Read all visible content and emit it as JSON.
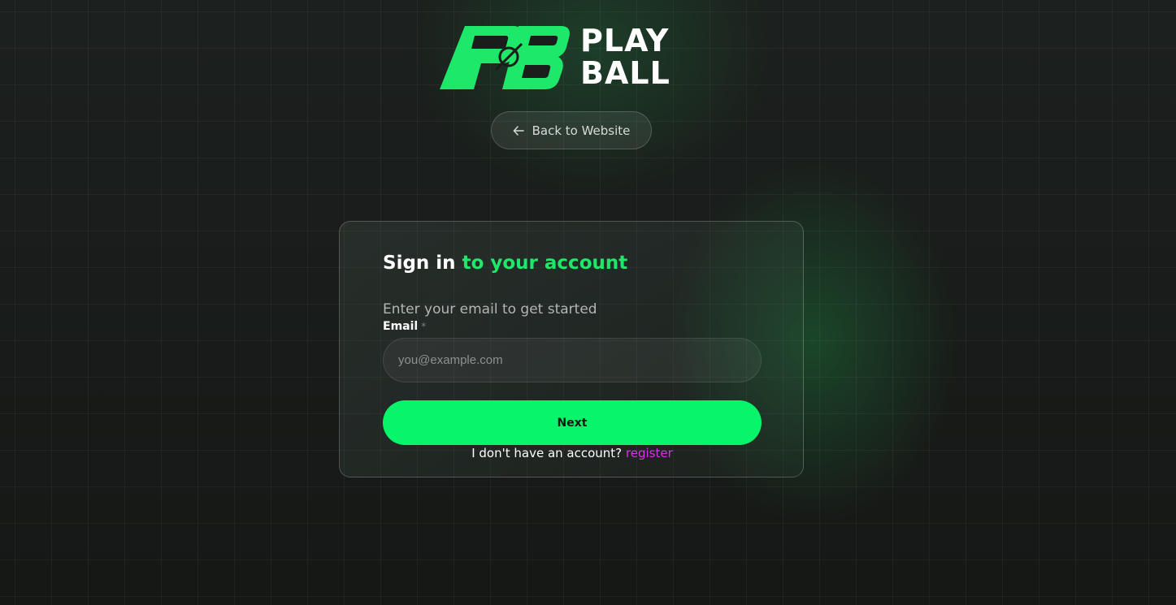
{
  "brand": {
    "logo_line1": "PLAY",
    "logo_line2": "BALL",
    "mark_color": "#1ee86a",
    "mark_icon": "pb-logo-mark"
  },
  "back_button": {
    "label": "Back to Website",
    "icon": "arrow-left-icon"
  },
  "card": {
    "title_white": "Sign in",
    "title_green": "to your account",
    "subtitle": "Enter your email to get started",
    "email_label": "Email",
    "email_required": "*",
    "email_placeholder": "you@example.com",
    "email_value": "",
    "next_label": "Next",
    "no_account_text": "I don't have an account?",
    "register_label": "register"
  },
  "colors": {
    "accent": "#08f46a",
    "link": "#d633e6",
    "background": "#1a1d1b"
  }
}
